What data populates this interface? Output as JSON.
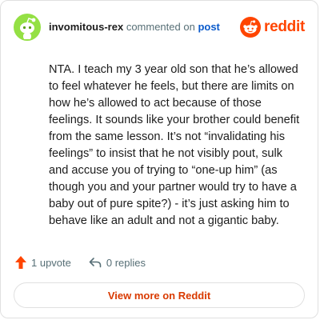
{
  "comment": {
    "username": "invomitous-rex",
    "action_text": "commented on",
    "post_link_label": "post",
    "avatar_icon": "snoo-avatar-icon",
    "avatar_color": "#94e044",
    "body": "NTA. I teach my 3 year old son that he’s allowed to feel whatever he feels, but there are limits on how he’s allowed to act because of those feelings. It sounds like your brother could benefit from the same lesson. It’s not “invalidating his feelings” to insist that he not visibly pout, sulk and accuse you of trying to “one-up him” (as though you and your partner would try to have a baby out of pure spite?) - it’s just asking him to behave like an adult and not a gigantic baby."
  },
  "brand": {
    "wordmark": "reddit",
    "logo_icon": "reddit-logo-icon",
    "color": "#ff4500"
  },
  "actions": {
    "upvote_icon": "upvote-arrow-icon",
    "upvote_label": "1 upvote",
    "reply_icon": "reply-arrow-icon",
    "replies_label": "0 replies"
  },
  "footer": {
    "view_more_label": "View more on Reddit",
    "accent_color": "#d93a00"
  }
}
